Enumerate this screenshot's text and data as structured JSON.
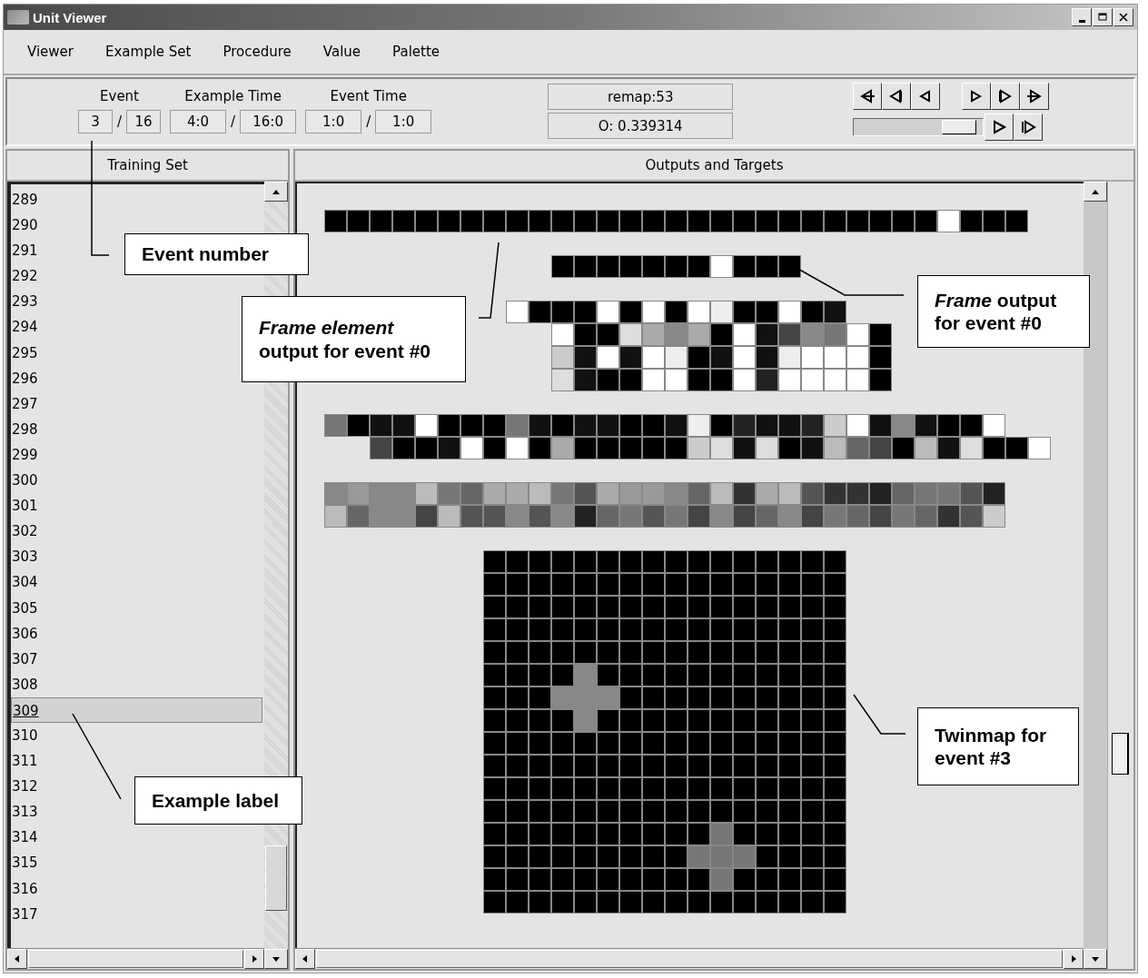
{
  "window": {
    "title": "Unit Viewer"
  },
  "menu": [
    {
      "label": "Viewer"
    },
    {
      "label": "Example Set"
    },
    {
      "label": "Procedure"
    },
    {
      "label": "Value"
    },
    {
      "label": "Palette"
    }
  ],
  "counters": [
    {
      "label": "Event",
      "fields": [
        "3",
        "16"
      ],
      "separator": "/"
    },
    {
      "label": "Example Time",
      "fields": [
        "4:0",
        "16:0"
      ],
      "separator": "/"
    },
    {
      "label": "Event Time",
      "fields": [
        "1:0",
        "1:0"
      ],
      "separator": "/"
    }
  ],
  "readouts": [
    "remap:53",
    "O: 0.339314"
  ],
  "speed_slider": {
    "level": 0.93
  },
  "training_set": {
    "title": "Training Set",
    "items": [
      {
        "label": "289",
        "selected": false
      },
      {
        "label": "290",
        "selected": false
      },
      {
        "label": "291",
        "selected": false
      },
      {
        "label": "292",
        "selected": false
      },
      {
        "label": "293",
        "selected": false
      },
      {
        "label": "294",
        "selected": false
      },
      {
        "label": "295",
        "selected": false
      },
      {
        "label": "296",
        "selected": false
      },
      {
        "label": "297",
        "selected": false
      },
      {
        "label": "298",
        "selected": false
      },
      {
        "label": "299",
        "selected": false
      },
      {
        "label": "300",
        "selected": false
      },
      {
        "label": "301",
        "selected": false
      },
      {
        "label": "302",
        "selected": false
      },
      {
        "label": "303",
        "selected": false
      },
      {
        "label": "304",
        "selected": false
      },
      {
        "label": "305",
        "selected": false
      },
      {
        "label": "306",
        "selected": false
      },
      {
        "label": "307",
        "selected": false
      },
      {
        "label": "308",
        "selected": false
      },
      {
        "label": "309",
        "selected": true
      },
      {
        "label": "310",
        "selected": false
      },
      {
        "label": "311",
        "selected": false
      },
      {
        "label": "312",
        "selected": false
      },
      {
        "label": "313",
        "selected": false
      },
      {
        "label": "314",
        "selected": false
      },
      {
        "label": "315",
        "selected": false
      },
      {
        "label": "316",
        "selected": false
      },
      {
        "label": "317",
        "selected": false
      }
    ]
  },
  "outputs": {
    "title": "Outputs and Targets",
    "groups": [
      {
        "rows": [
          {
            "cells": [
              {
                "color": "#000000"
              },
              {
                "color": "#000000"
              },
              {
                "color": "#000000"
              },
              {
                "color": "#000000"
              },
              {
                "color": "#000000"
              },
              {
                "color": "#000000"
              },
              {
                "color": "#000000"
              },
              {
                "color": "#000000"
              },
              {
                "color": "#000000"
              },
              {
                "color": "#000000"
              },
              {
                "color": "#000000"
              },
              {
                "color": "#000000"
              },
              {
                "color": "#000000"
              },
              {
                "color": "#000000"
              },
              {
                "color": "#000000"
              },
              {
                "color": "#000000"
              },
              {
                "color": "#000000"
              },
              {
                "color": "#000000"
              },
              {
                "color": "#000000"
              },
              {
                "color": "#000000"
              },
              {
                "color": "#000000"
              },
              {
                "color": "#000000"
              },
              {
                "color": "#000000"
              },
              {
                "color": "#000000"
              },
              {
                "color": "#000000"
              },
              {
                "color": "#000000"
              },
              {
                "color": "#000000"
              },
              {
                "color": "#ffffff"
              },
              {
                "color": "#000000"
              },
              {
                "color": "#000000"
              },
              {
                "color": "#000000"
              }
            ]
          }
        ]
      },
      {
        "rows": [
          {
            "cells": [
              {
                "color": "#000000"
              },
              {
                "color": "#000000"
              },
              {
                "color": "#000000"
              },
              {
                "color": "#000000"
              },
              {
                "color": "#000000"
              },
              {
                "color": "#000000"
              },
              {
                "color": "#000000"
              },
              {
                "color": "#ffffff"
              },
              {
                "color": "#000000"
              },
              {
                "color": "#000000"
              },
              {
                "color": "#000000"
              }
            ]
          }
        ]
      },
      {
        "rows": [
          {
            "cells": [
              {
                "color": "#ffffff"
              },
              {
                "color": "#000000"
              },
              {
                "color": "#000000"
              },
              {
                "color": "#000000"
              },
              {
                "color": "#ffffff"
              },
              {
                "color": "#000000"
              },
              {
                "color": "#ffffff"
              },
              {
                "color": "#000000"
              },
              {
                "color": "#ffffff"
              },
              {
                "color": "#eeeeee"
              },
              {
                "color": "#000000"
              },
              {
                "color": "#000000"
              },
              {
                "color": "#ffffff"
              },
              {
                "color": "#000000"
              },
              {
                "color": "#111111"
              }
            ]
          },
          {
            "cells": [
              {
                "color": "#ffffff"
              },
              {
                "color": "#000000"
              },
              {
                "color": "#000000"
              },
              {
                "color": "#dddddd"
              },
              {
                "color": "#aaaaaa"
              },
              {
                "color": "#888888"
              },
              {
                "color": "#aaaaaa"
              },
              {
                "color": "#000000"
              },
              {
                "color": "#ffffff"
              },
              {
                "color": "#111111"
              },
              {
                "color": "#444444"
              },
              {
                "color": "#888888"
              },
              {
                "color": "#777777"
              },
              {
                "color": "#ffffff"
              },
              {
                "color": "#000000"
              }
            ]
          },
          {
            "cells": [
              {
                "color": "#cccccc"
              },
              {
                "color": "#111111"
              },
              {
                "color": "#ffffff"
              },
              {
                "color": "#111111"
              },
              {
                "color": "#ffffff"
              },
              {
                "color": "#eeeeee"
              },
              {
                "color": "#000000"
              },
              {
                "color": "#111111"
              },
              {
                "color": "#ffffff"
              },
              {
                "color": "#111111"
              },
              {
                "color": "#eeeeee"
              },
              {
                "color": "#ffffff"
              },
              {
                "color": "#ffffff"
              },
              {
                "color": "#ffffff"
              },
              {
                "color": "#000000"
              }
            ]
          },
          {
            "cells": [
              {
                "color": "#dddddd"
              },
              {
                "color": "#111111"
              },
              {
                "color": "#000000"
              },
              {
                "color": "#000000"
              },
              {
                "color": "#ffffff"
              },
              {
                "color": "#ffffff"
              },
              {
                "color": "#000000"
              },
              {
                "color": "#000000"
              },
              {
                "color": "#ffffff"
              },
              {
                "color": "#222222"
              },
              {
                "color": "#ffffff"
              },
              {
                "color": "#ffffff"
              },
              {
                "color": "#ffffff"
              },
              {
                "color": "#ffffff"
              },
              {
                "color": "#000000"
              }
            ]
          }
        ]
      },
      {
        "rows": [
          {
            "cells": [
              {
                "color": "#777777"
              },
              {
                "color": "#000000"
              },
              {
                "color": "#111111"
              },
              {
                "color": "#111111"
              },
              {
                "color": "#ffffff"
              },
              {
                "color": "#000000"
              },
              {
                "color": "#000000"
              },
              {
                "color": "#000000"
              },
              {
                "color": "#777777"
              },
              {
                "color": "#111111"
              },
              {
                "color": "#000000"
              },
              {
                "color": "#111111"
              },
              {
                "color": "#111111"
              },
              {
                "color": "#000000"
              },
              {
                "color": "#000000"
              },
              {
                "color": "#111111"
              },
              {
                "color": "#eeeeee"
              },
              {
                "color": "#000000"
              },
              {
                "color": "#222222"
              },
              {
                "color": "#111111"
              },
              {
                "color": "#111111"
              },
              {
                "color": "#222222"
              },
              {
                "color": "#cccccc"
              },
              {
                "color": "#ffffff"
              },
              {
                "color": "#111111"
              },
              {
                "color": "#888888"
              },
              {
                "color": "#111111"
              },
              {
                "color": "#000000"
              },
              {
                "color": "#000000"
              },
              {
                "color": "#ffffff"
              }
            ]
          },
          {
            "cells": [
              {
                "color": "#444444"
              },
              {
                "color": "#000000"
              },
              {
                "color": "#000000"
              },
              {
                "color": "#111111"
              },
              {
                "color": "#ffffff"
              },
              {
                "color": "#000000"
              },
              {
                "color": "#ffffff"
              },
              {
                "color": "#000000"
              },
              {
                "color": "#aaaaaa"
              },
              {
                "color": "#000000"
              },
              {
                "color": "#000000"
              },
              {
                "color": "#000000"
              },
              {
                "color": "#000000"
              },
              {
                "color": "#000000"
              },
              {
                "color": "#cccccc"
              },
              {
                "color": "#dddddd"
              },
              {
                "color": "#111111"
              },
              {
                "color": "#dddddd"
              },
              {
                "color": "#000000"
              },
              {
                "color": "#111111"
              },
              {
                "color": "#bbbbbb"
              },
              {
                "color": "#666666"
              },
              {
                "color": "#444444"
              },
              {
                "color": "#000000"
              },
              {
                "color": "#bbbbbb"
              },
              {
                "color": "#111111"
              },
              {
                "color": "#dddddd"
              },
              {
                "color": "#000000"
              },
              {
                "color": "#000000"
              },
              {
                "color": "#ffffff"
              }
            ]
          }
        ]
      },
      {
        "rows": [
          {
            "cells": [
              {
                "color": "#888888"
              },
              {
                "color": "#999999"
              },
              {
                "color": "#888888"
              },
              {
                "color": "#888888"
              },
              {
                "color": "#bbbbbb"
              },
              {
                "color": "#777777"
              },
              {
                "color": "#666666"
              },
              {
                "color": "#aaaaaa"
              },
              {
                "color": "#aaaaaa"
              },
              {
                "color": "#bbbbbb"
              },
              {
                "color": "#777777"
              },
              {
                "color": "#555555"
              },
              {
                "color": "#aaaaaa"
              },
              {
                "color": "#999999"
              },
              {
                "color": "#999999"
              },
              {
                "color": "#888888"
              },
              {
                "color": "#666666"
              },
              {
                "color": "#bbbbbb"
              },
              {
                "color": "#333333"
              },
              {
                "color": "#aaaaaa"
              },
              {
                "color": "#bbbbbb"
              },
              {
                "color": "#555555"
              },
              {
                "color": "#333333"
              },
              {
                "color": "#333333"
              },
              {
                "color": "#222222"
              },
              {
                "color": "#666666"
              },
              {
                "color": "#777777"
              },
              {
                "color": "#777777"
              },
              {
                "color": "#555555"
              },
              {
                "color": "#222222"
              }
            ]
          },
          {
            "cells": [
              {
                "color": "#bbbbbb"
              },
              {
                "color": "#666666"
              },
              {
                "color": "#888888"
              },
              {
                "color": "#888888"
              },
              {
                "color": "#444444"
              },
              {
                "color": "#bbbbbb"
              },
              {
                "color": "#555555"
              },
              {
                "color": "#555555"
              },
              {
                "color": "#888888"
              },
              {
                "color": "#555555"
              },
              {
                "color": "#888888"
              },
              {
                "color": "#222222"
              },
              {
                "color": "#666666"
              },
              {
                "color": "#777777"
              },
              {
                "color": "#555555"
              },
              {
                "color": "#777777"
              },
              {
                "color": "#444444"
              },
              {
                "color": "#888888"
              },
              {
                "color": "#444444"
              },
              {
                "color": "#666666"
              },
              {
                "color": "#888888"
              },
              {
                "color": "#444444"
              },
              {
                "color": "#777777"
              },
              {
                "color": "#666666"
              },
              {
                "color": "#444444"
              },
              {
                "color": "#777777"
              },
              {
                "color": "#666666"
              },
              {
                "color": "#333333"
              },
              {
                "color": "#555555"
              },
              {
                "color": "#cccccc"
              }
            ]
          }
        ]
      },
      {
        "rows": [
          {
            "cells": [
              {
                "color": "#000000"
              },
              {
                "color": "#000000"
              },
              {
                "color": "#000000"
              },
              {
                "color": "#000000"
              },
              {
                "color": "#000000"
              },
              {
                "color": "#000000"
              },
              {
                "color": "#000000"
              },
              {
                "color": "#000000"
              },
              {
                "color": "#000000"
              },
              {
                "color": "#000000"
              },
              {
                "color": "#000000"
              },
              {
                "color": "#000000"
              },
              {
                "color": "#000000"
              },
              {
                "color": "#000000"
              },
              {
                "color": "#000000"
              },
              {
                "color": "#000000"
              }
            ]
          },
          {
            "cells": [
              {
                "color": "#000000"
              },
              {
                "color": "#000000"
              },
              {
                "color": "#000000"
              },
              {
                "color": "#000000"
              },
              {
                "color": "#000000"
              },
              {
                "color": "#000000"
              },
              {
                "color": "#000000"
              },
              {
                "color": "#000000"
              },
              {
                "color": "#000000"
              },
              {
                "color": "#000000"
              },
              {
                "color": "#000000"
              },
              {
                "color": "#000000"
              },
              {
                "color": "#000000"
              },
              {
                "color": "#000000"
              },
              {
                "color": "#000000"
              },
              {
                "color": "#000000"
              }
            ]
          },
          {
            "cells": [
              {
                "color": "#000000"
              },
              {
                "color": "#000000"
              },
              {
                "color": "#000000"
              },
              {
                "color": "#000000"
              },
              {
                "color": "#000000"
              },
              {
                "color": "#000000"
              },
              {
                "color": "#000000"
              },
              {
                "color": "#000000"
              },
              {
                "color": "#000000"
              },
              {
                "color": "#000000"
              },
              {
                "color": "#000000"
              },
              {
                "color": "#000000"
              },
              {
                "color": "#000000"
              },
              {
                "color": "#000000"
              },
              {
                "color": "#000000"
              },
              {
                "color": "#000000"
              }
            ]
          },
          {
            "cells": [
              {
                "color": "#000000"
              },
              {
                "color": "#000000"
              },
              {
                "color": "#000000"
              },
              {
                "color": "#000000"
              },
              {
                "color": "#000000"
              },
              {
                "color": "#000000"
              },
              {
                "color": "#000000"
              },
              {
                "color": "#000000"
              },
              {
                "color": "#000000"
              },
              {
                "color": "#000000"
              },
              {
                "color": "#000000"
              },
              {
                "color": "#000000"
              },
              {
                "color": "#000000"
              },
              {
                "color": "#000000"
              },
              {
                "color": "#000000"
              },
              {
                "color": "#000000"
              }
            ]
          },
          {
            "cells": [
              {
                "color": "#000000"
              },
              {
                "color": "#000000"
              },
              {
                "color": "#000000"
              },
              {
                "color": "#000000"
              },
              {
                "color": "#000000"
              },
              {
                "color": "#000000"
              },
              {
                "color": "#000000"
              },
              {
                "color": "#000000"
              },
              {
                "color": "#000000"
              },
              {
                "color": "#000000"
              },
              {
                "color": "#000000"
              },
              {
                "color": "#000000"
              },
              {
                "color": "#000000"
              },
              {
                "color": "#000000"
              },
              {
                "color": "#000000"
              },
              {
                "color": "#000000"
              }
            ]
          },
          {
            "cells": [
              {
                "color": "#000000"
              },
              {
                "color": "#000000"
              },
              {
                "color": "#000000"
              },
              {
                "color": "#000000"
              },
              {
                "color": "#888888"
              },
              {
                "color": "#000000"
              },
              {
                "color": "#000000"
              },
              {
                "color": "#000000"
              },
              {
                "color": "#000000"
              },
              {
                "color": "#000000"
              },
              {
                "color": "#000000"
              },
              {
                "color": "#000000"
              },
              {
                "color": "#000000"
              },
              {
                "color": "#000000"
              },
              {
                "color": "#000000"
              },
              {
                "color": "#000000"
              }
            ]
          },
          {
            "cells": [
              {
                "color": "#000000"
              },
              {
                "color": "#000000"
              },
              {
                "color": "#000000"
              },
              {
                "color": "#888888"
              },
              {
                "color": "#888888"
              },
              {
                "color": "#888888"
              },
              {
                "color": "#000000"
              },
              {
                "color": "#000000"
              },
              {
                "color": "#000000"
              },
              {
                "color": "#000000"
              },
              {
                "color": "#000000"
              },
              {
                "color": "#000000"
              },
              {
                "color": "#000000"
              },
              {
                "color": "#000000"
              },
              {
                "color": "#000000"
              },
              {
                "color": "#000000"
              }
            ]
          },
          {
            "cells": [
              {
                "color": "#000000"
              },
              {
                "color": "#000000"
              },
              {
                "color": "#000000"
              },
              {
                "color": "#000000"
              },
              {
                "color": "#888888"
              },
              {
                "color": "#000000"
              },
              {
                "color": "#000000"
              },
              {
                "color": "#000000"
              },
              {
                "color": "#000000"
              },
              {
                "color": "#000000"
              },
              {
                "color": "#000000"
              },
              {
                "color": "#000000"
              },
              {
                "color": "#000000"
              },
              {
                "color": "#000000"
              },
              {
                "color": "#000000"
              },
              {
                "color": "#000000"
              }
            ]
          },
          {
            "cells": [
              {
                "color": "#000000"
              },
              {
                "color": "#000000"
              },
              {
                "color": "#000000"
              },
              {
                "color": "#000000"
              },
              {
                "color": "#000000"
              },
              {
                "color": "#000000"
              },
              {
                "color": "#000000"
              },
              {
                "color": "#000000"
              },
              {
                "color": "#000000"
              },
              {
                "color": "#000000"
              },
              {
                "color": "#000000"
              },
              {
                "color": "#000000"
              },
              {
                "color": "#000000"
              },
              {
                "color": "#000000"
              },
              {
                "color": "#000000"
              },
              {
                "color": "#000000"
              }
            ]
          },
          {
            "cells": [
              {
                "color": "#000000"
              },
              {
                "color": "#000000"
              },
              {
                "color": "#000000"
              },
              {
                "color": "#000000"
              },
              {
                "color": "#000000"
              },
              {
                "color": "#000000"
              },
              {
                "color": "#000000"
              },
              {
                "color": "#000000"
              },
              {
                "color": "#000000"
              },
              {
                "color": "#000000"
              },
              {
                "color": "#000000"
              },
              {
                "color": "#000000"
              },
              {
                "color": "#000000"
              },
              {
                "color": "#000000"
              },
              {
                "color": "#000000"
              },
              {
                "color": "#000000"
              }
            ]
          },
          {
            "cells": [
              {
                "color": "#000000"
              },
              {
                "color": "#000000"
              },
              {
                "color": "#000000"
              },
              {
                "color": "#000000"
              },
              {
                "color": "#000000"
              },
              {
                "color": "#000000"
              },
              {
                "color": "#000000"
              },
              {
                "color": "#000000"
              },
              {
                "color": "#000000"
              },
              {
                "color": "#000000"
              },
              {
                "color": "#000000"
              },
              {
                "color": "#000000"
              },
              {
                "color": "#000000"
              },
              {
                "color": "#000000"
              },
              {
                "color": "#000000"
              },
              {
                "color": "#000000"
              }
            ]
          },
          {
            "cells": [
              {
                "color": "#000000"
              },
              {
                "color": "#000000"
              },
              {
                "color": "#000000"
              },
              {
                "color": "#000000"
              },
              {
                "color": "#000000"
              },
              {
                "color": "#000000"
              },
              {
                "color": "#000000"
              },
              {
                "color": "#000000"
              },
              {
                "color": "#000000"
              },
              {
                "color": "#000000"
              },
              {
                "color": "#000000"
              },
              {
                "color": "#000000"
              },
              {
                "color": "#000000"
              },
              {
                "color": "#000000"
              },
              {
                "color": "#000000"
              },
              {
                "color": "#000000"
              }
            ]
          },
          {
            "cells": [
              {
                "color": "#000000"
              },
              {
                "color": "#000000"
              },
              {
                "color": "#000000"
              },
              {
                "color": "#000000"
              },
              {
                "color": "#000000"
              },
              {
                "color": "#000000"
              },
              {
                "color": "#000000"
              },
              {
                "color": "#000000"
              },
              {
                "color": "#000000"
              },
              {
                "color": "#000000"
              },
              {
                "color": "#777777"
              },
              {
                "color": "#000000"
              },
              {
                "color": "#000000"
              },
              {
                "color": "#000000"
              },
              {
                "color": "#000000"
              },
              {
                "color": "#000000"
              }
            ]
          },
          {
            "cells": [
              {
                "color": "#000000"
              },
              {
                "color": "#000000"
              },
              {
                "color": "#000000"
              },
              {
                "color": "#000000"
              },
              {
                "color": "#000000"
              },
              {
                "color": "#000000"
              },
              {
                "color": "#000000"
              },
              {
                "color": "#000000"
              },
              {
                "color": "#000000"
              },
              {
                "color": "#777777"
              },
              {
                "color": "#777777"
              },
              {
                "color": "#777777"
              },
              {
                "color": "#000000"
              },
              {
                "color": "#000000"
              },
              {
                "color": "#000000"
              },
              {
                "color": "#000000"
              }
            ]
          },
          {
            "cells": [
              {
                "color": "#000000"
              },
              {
                "color": "#000000"
              },
              {
                "color": "#000000"
              },
              {
                "color": "#000000"
              },
              {
                "color": "#000000"
              },
              {
                "color": "#000000"
              },
              {
                "color": "#000000"
              },
              {
                "color": "#000000"
              },
              {
                "color": "#000000"
              },
              {
                "color": "#000000"
              },
              {
                "color": "#777777"
              },
              {
                "color": "#000000"
              },
              {
                "color": "#000000"
              },
              {
                "color": "#000000"
              },
              {
                "color": "#000000"
              },
              {
                "color": "#000000"
              }
            ]
          },
          {
            "cells": [
              {
                "color": "#000000"
              },
              {
                "color": "#000000"
              },
              {
                "color": "#000000"
              },
              {
                "color": "#000000"
              },
              {
                "color": "#000000"
              },
              {
                "color": "#000000"
              },
              {
                "color": "#000000"
              },
              {
                "color": "#000000"
              },
              {
                "color": "#000000"
              },
              {
                "color": "#000000"
              },
              {
                "color": "#000000"
              },
              {
                "color": "#000000"
              },
              {
                "color": "#000000"
              },
              {
                "color": "#000000"
              },
              {
                "color": "#000000"
              },
              {
                "color": "#000000"
              }
            ]
          }
        ]
      }
    ]
  },
  "callouts": [
    {
      "text": "Event number"
    },
    {
      "text": "*Frame element* output for event #0"
    },
    {
      "text": "*Frame* output for event #0"
    },
    {
      "text": "Twinmap for event #3"
    },
    {
      "text": "Example label"
    }
  ]
}
